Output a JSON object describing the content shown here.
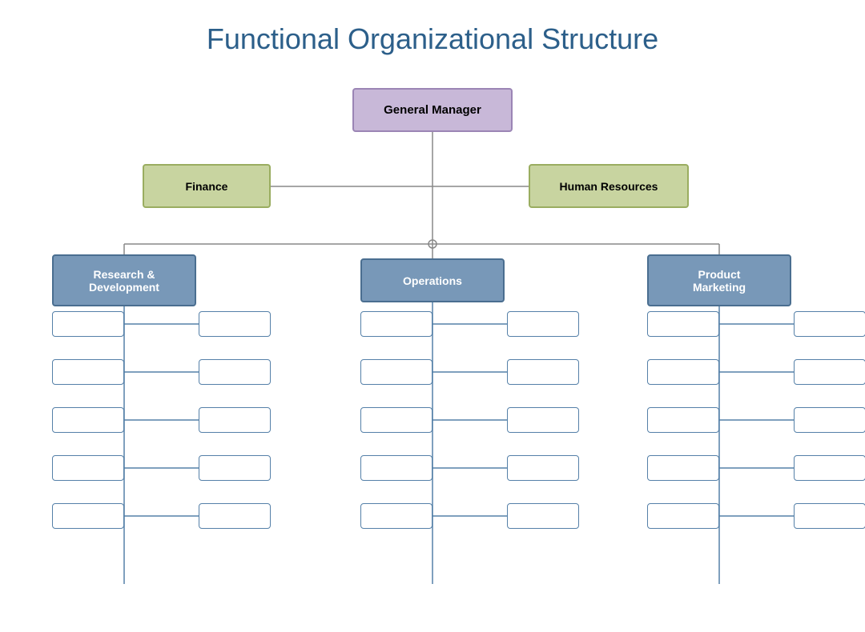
{
  "title": "Functional Organizational Structure",
  "boxes": {
    "general_manager": "General Manager",
    "finance": "Finance",
    "hr": "Human Resources",
    "rd": "Research &\nDevelopment",
    "ops": "Operations",
    "pm": "Product\nMarketing"
  }
}
